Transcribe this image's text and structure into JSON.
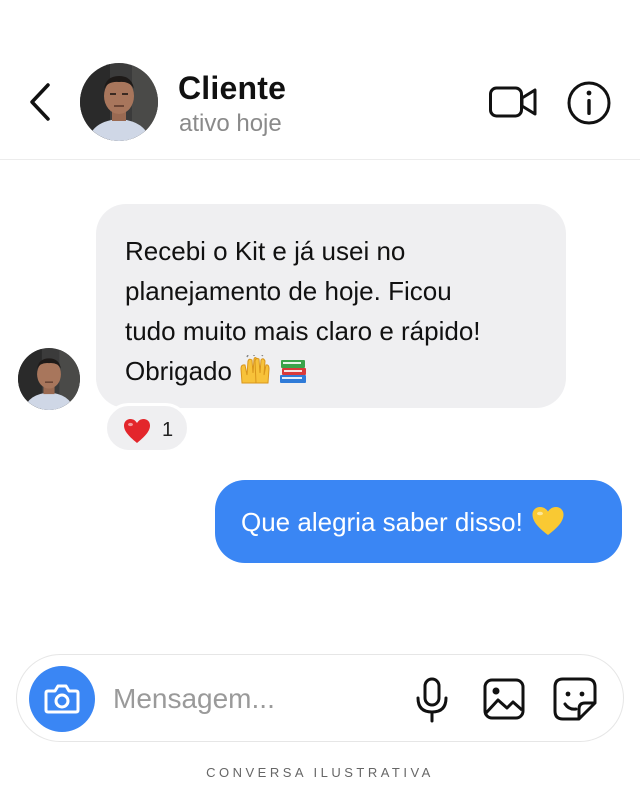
{
  "header": {
    "back_icon": "chevron-left-icon",
    "name": "Cliente",
    "status": "ativo hoje",
    "video_icon": "video-camera-icon",
    "info_icon": "info-icon"
  },
  "messages": [
    {
      "direction": "incoming",
      "lines": [
        "Recebi o Kit e já usei no",
        "planejamento de hoje. Ficou",
        "tudo muito mais claro e rápido!",
        "Obrigado"
      ],
      "emojis": [
        "raising-hands-emoji",
        "books-emoji"
      ],
      "reaction": {
        "emoji": "red-heart-emoji",
        "count": "1"
      }
    },
    {
      "direction": "outgoing",
      "text": "Que alegria saber disso!",
      "emoji": "yellow-heart-emoji"
    }
  ],
  "composer": {
    "placeholder": "Mensagem...",
    "camera_icon": "camera-icon",
    "mic_icon": "microphone-icon",
    "image_icon": "image-icon",
    "sticker_icon": "sticker-icon"
  },
  "colors": {
    "outgoing_bubble": "#3a86f4",
    "incoming_bubble": "#efeff1",
    "camera_button": "#3a86f4"
  },
  "footer": {
    "label": "CONVERSA ILUSTRATIVA"
  }
}
